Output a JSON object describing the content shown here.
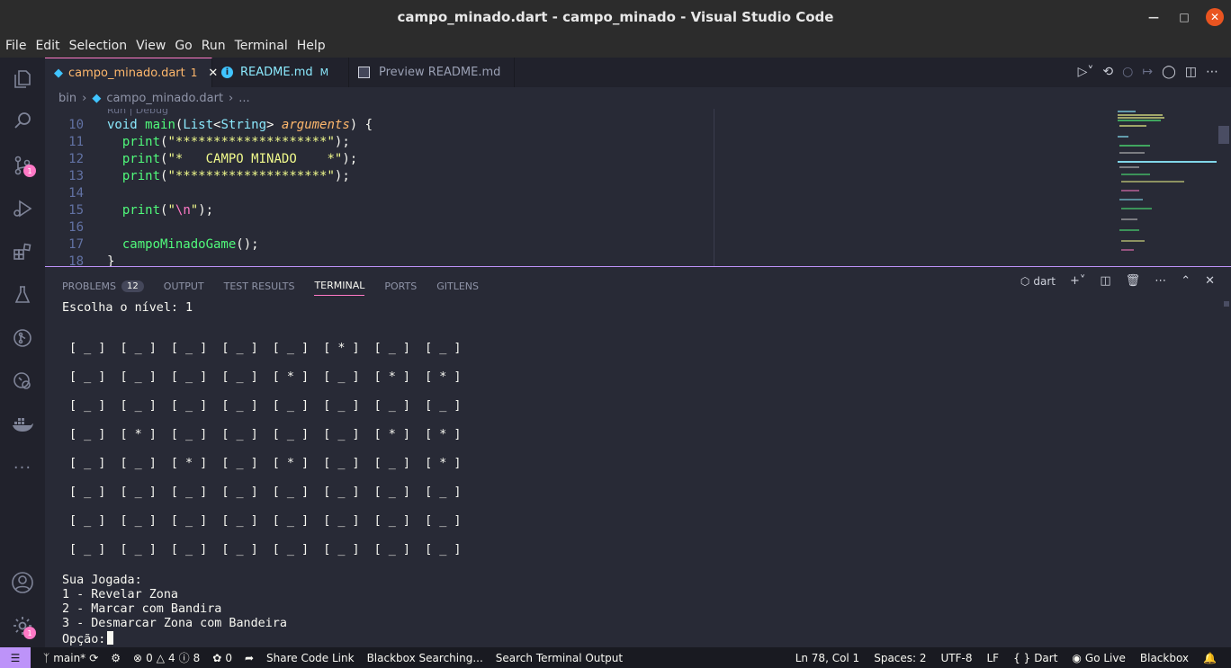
{
  "window": {
    "title": "campo_minado.dart - campo_minado - Visual Studio Code"
  },
  "menu": [
    "File",
    "Edit",
    "Selection",
    "View",
    "Go",
    "Run",
    "Terminal",
    "Help"
  ],
  "activity": {
    "scm_badge": "1",
    "settings_badge": "1"
  },
  "tabs": [
    {
      "label": "campo_minado.dart",
      "status": "1"
    },
    {
      "label": "README.md",
      "status": "M"
    },
    {
      "label": "Preview README.md"
    }
  ],
  "breadcrumb": {
    "folder": "bin",
    "file": "campo_minado.dart",
    "more": "..."
  },
  "editor": {
    "codelens": "Run | Debug",
    "line_numbers": [
      "10",
      "11",
      "12",
      "13",
      "14",
      "15",
      "16",
      "17",
      "18"
    ],
    "lines": {
      "l10_kw": "void",
      "l10_fn": "main",
      "l10_p1": "(",
      "l10_ty1": "List",
      "l10_p2": "<",
      "l10_ty2": "String",
      "l10_p3": "> ",
      "l10_param": "arguments",
      "l10_p4": ") {",
      "l11_fn": "print",
      "l11_p1": "(",
      "l11_str": "\"********************\"",
      "l11_p2": ");",
      "l12_fn": "print",
      "l12_p1": "(",
      "l12_str": "\"*   CAMPO MINADO    *\"",
      "l12_p2": ");",
      "l13_fn": "print",
      "l13_p1": "(",
      "l13_str": "\"********************\"",
      "l13_p2": ");",
      "l15_fn": "print",
      "l15_p1": "(",
      "l15_q1": "\"",
      "l15_esc": "\\n",
      "l15_q2": "\"",
      "l15_p2": ");",
      "l17_fn": "campoMinadoGame",
      "l17_p": "();",
      "l18": "}"
    }
  },
  "panel": {
    "tabs": [
      "PROBLEMS",
      "OUTPUT",
      "TEST RESULTS",
      "TERMINAL",
      "PORTS",
      "GITLENS"
    ],
    "problems_count": "12",
    "shell_label": "dart"
  },
  "terminal": {
    "lines": [
      "Escolha o nível: 1",
      " [ _ ]  [ _ ]  [ _ ]  [ _ ]  [ _ ]  [ * ]  [ _ ]  [ _ ]",
      " [ _ ]  [ _ ]  [ _ ]  [ _ ]  [ * ]  [ _ ]  [ * ]  [ * ]",
      " [ _ ]  [ _ ]  [ _ ]  [ _ ]  [ _ ]  [ _ ]  [ _ ]  [ _ ]",
      " [ _ ]  [ * ]  [ _ ]  [ _ ]  [ _ ]  [ _ ]  [ * ]  [ * ]",
      " [ _ ]  [ _ ]  [ * ]  [ _ ]  [ * ]  [ _ ]  [ _ ]  [ * ]",
      " [ _ ]  [ _ ]  [ _ ]  [ _ ]  [ _ ]  [ _ ]  [ _ ]  [ _ ]",
      " [ _ ]  [ _ ]  [ _ ]  [ _ ]  [ _ ]  [ _ ]  [ _ ]  [ _ ]",
      " [ _ ]  [ _ ]  [ _ ]  [ _ ]  [ _ ]  [ _ ]  [ _ ]  [ _ ]",
      "Sua Jogada:",
      "1 - Revelar Zona",
      "2 - Marcar com Bandira",
      "3 - Desmarcar Zona com Bandeira",
      "Opção:"
    ]
  },
  "status": {
    "branch": "main*",
    "errors": "0",
    "warnings": "4",
    "infos": "8",
    "ports": "0",
    "share": "Share Code Link",
    "blackbox_search": "Blackbox Searching...",
    "search_terminal": "Search Terminal Output",
    "position": "Ln 78, Col 1",
    "spaces": "Spaces: 2",
    "encoding": "UTF-8",
    "eol": "LF",
    "language": "Dart",
    "golive": "Go Live",
    "blackbox": "Blackbox"
  },
  "colors": {
    "accent": "#ff79c6",
    "purple": "#bd93f9",
    "background": "#282a36"
  }
}
